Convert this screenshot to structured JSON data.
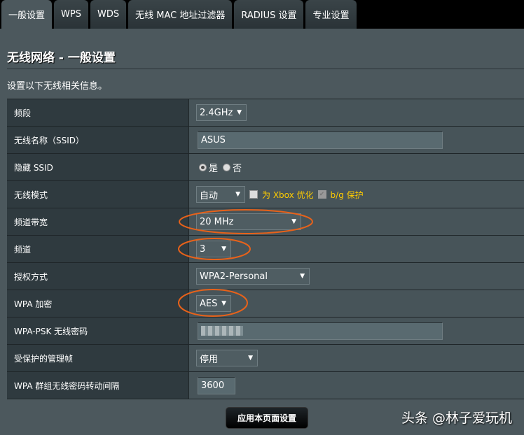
{
  "tabs": [
    "一般设置",
    "WPS",
    "WDS",
    "无线 MAC 地址过滤器",
    "RADIUS 设置",
    "专业设置"
  ],
  "title": "无线网络 - 一般设置",
  "description": "设置以下无线相关信息。",
  "rows": {
    "band": {
      "label": "频段",
      "value": "2.4GHz"
    },
    "ssid": {
      "label": "无线名称（SSID）",
      "value": "ASUS"
    },
    "hide_ssid": {
      "label": "隐藏 SSID",
      "yes": "是",
      "no": "否",
      "selected": "是"
    },
    "mode": {
      "label": "无线模式",
      "value": "自动",
      "xbox": "为 Xbox 优化",
      "bg": "b/g 保护"
    },
    "bandwidth": {
      "label": "频道带宽",
      "value": "20 MHz"
    },
    "channel": {
      "label": "频道",
      "value": "3"
    },
    "auth": {
      "label": "授权方式",
      "value": "WPA2-Personal"
    },
    "wpa_enc": {
      "label": "WPA 加密",
      "value": "AES"
    },
    "psk": {
      "label": "WPA-PSK 无线密码"
    },
    "pmf": {
      "label": "受保护的管理帧",
      "value": "停用"
    },
    "rekey": {
      "label": "WPA 群组无线密码转动间隔",
      "value": "3600"
    }
  },
  "apply_label": "应用本页面设置",
  "watermark": "头条 @林子爱玩机",
  "colors": {
    "annotation": "#e8621a",
    "highlight": "#ffcc00"
  }
}
